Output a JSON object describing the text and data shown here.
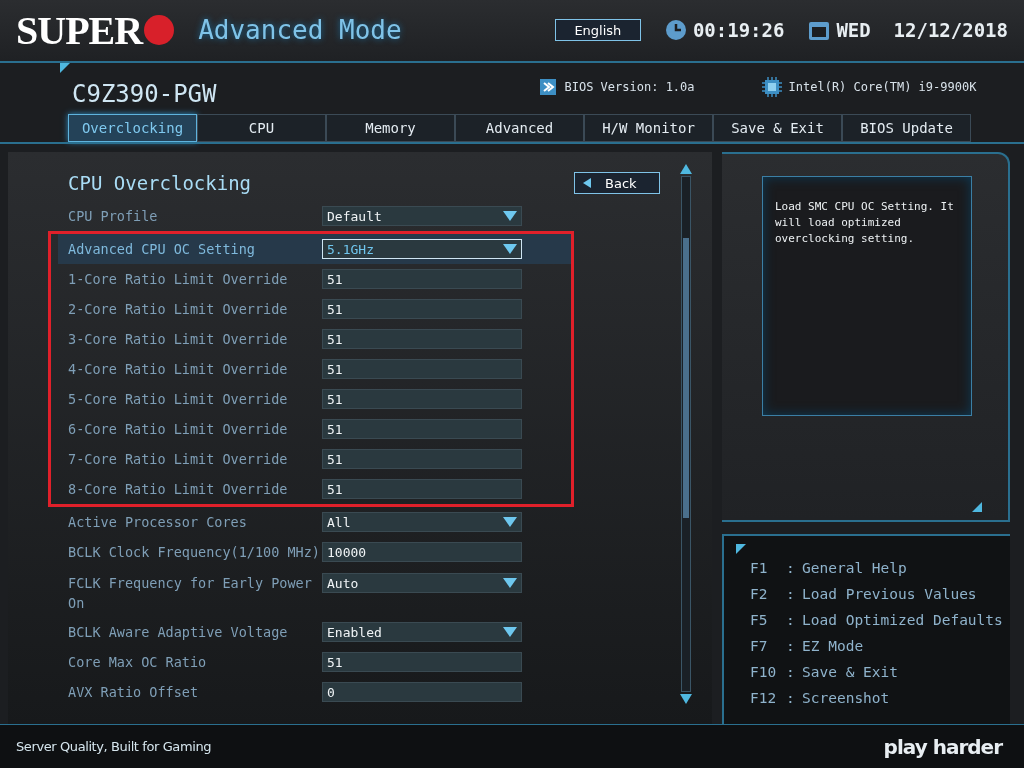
{
  "header": {
    "logo": "SUPER",
    "mode_title": "Advanced Mode",
    "language": "English",
    "time": "00:19:26",
    "date": "WED  12/12/2018"
  },
  "board": {
    "model": "C9Z390-PGW",
    "bios_version": "BIOS Version: 1.0a",
    "cpu": "Intel(R) Core(TM) i9-9900K"
  },
  "tabs": [
    {
      "label": "Overclocking",
      "selected": true
    },
    {
      "label": "CPU",
      "selected": false
    },
    {
      "label": "Memory",
      "selected": false
    },
    {
      "label": "Advanced",
      "selected": false
    },
    {
      "label": "H/W Monitor",
      "selected": false
    },
    {
      "label": "Save & Exit",
      "selected": false
    },
    {
      "label": "BIOS Update",
      "selected": false
    }
  ],
  "page": {
    "title": "CPU Overclocking",
    "back_button": "Back"
  },
  "setting_blocks": [
    {
      "framed": false,
      "items": [
        {
          "label": "CPU Profile",
          "value": "Default",
          "kind": "select",
          "selected": false
        }
      ]
    },
    {
      "framed": true,
      "items": [
        {
          "label": "Advanced CPU OC Setting",
          "value": "5.1GHz",
          "kind": "select",
          "selected": true
        },
        {
          "label": "1-Core Ratio Limit Override",
          "value": "51",
          "kind": "number",
          "selected": false
        },
        {
          "label": "2-Core Ratio Limit Override",
          "value": "51",
          "kind": "number",
          "selected": false
        },
        {
          "label": "3-Core Ratio Limit Override",
          "value": "51",
          "kind": "number",
          "selected": false
        },
        {
          "label": "4-Core Ratio Limit Override",
          "value": "51",
          "kind": "number",
          "selected": false
        },
        {
          "label": "5-Core Ratio Limit Override",
          "value": "51",
          "kind": "number",
          "selected": false
        },
        {
          "label": "6-Core Ratio Limit Override",
          "value": "51",
          "kind": "number",
          "selected": false
        },
        {
          "label": "7-Core Ratio Limit Override",
          "value": "51",
          "kind": "number",
          "selected": false
        },
        {
          "label": "8-Core Ratio Limit Override",
          "value": "51",
          "kind": "number",
          "selected": false
        }
      ]
    },
    {
      "framed": false,
      "items": [
        {
          "label": "Active Processor Cores",
          "value": "All",
          "kind": "select",
          "selected": false
        },
        {
          "label": "BCLK Clock Frequency(1/100 MHz)",
          "value": "10000",
          "kind": "number",
          "selected": false
        },
        {
          "label": "FCLK Frequency for Early Power On",
          "value": "Auto",
          "kind": "select",
          "selected": false
        },
        {
          "label": "BCLK Aware Adaptive Voltage",
          "value": "Enabled",
          "kind": "select",
          "selected": false
        },
        {
          "label": "Core Max OC Ratio",
          "value": "51",
          "kind": "number",
          "selected": false
        },
        {
          "label": "AVX Ratio Offset",
          "value": "0",
          "kind": "number",
          "selected": false
        }
      ]
    }
  ],
  "help_text": "Load SMC CPU OC Setting. It will load optimized overclocking setting.",
  "hotkeys": [
    {
      "key": "F1",
      "separator": ":",
      "action": "General Help"
    },
    {
      "key": "F2",
      "separator": ":",
      "action": "Load Previous Values"
    },
    {
      "key": "F5",
      "separator": ":",
      "action": "Load Optimized Defaults"
    },
    {
      "key": "F7",
      "separator": ":",
      "action": "EZ Mode"
    },
    {
      "key": "F10",
      "separator": ":",
      "action": "Save & Exit"
    },
    {
      "key": "F12",
      "separator": ":",
      "action": "Screenshot"
    }
  ],
  "footer": {
    "slogan": "Server Quality, Built for Gaming",
    "brand": "play harder"
  }
}
